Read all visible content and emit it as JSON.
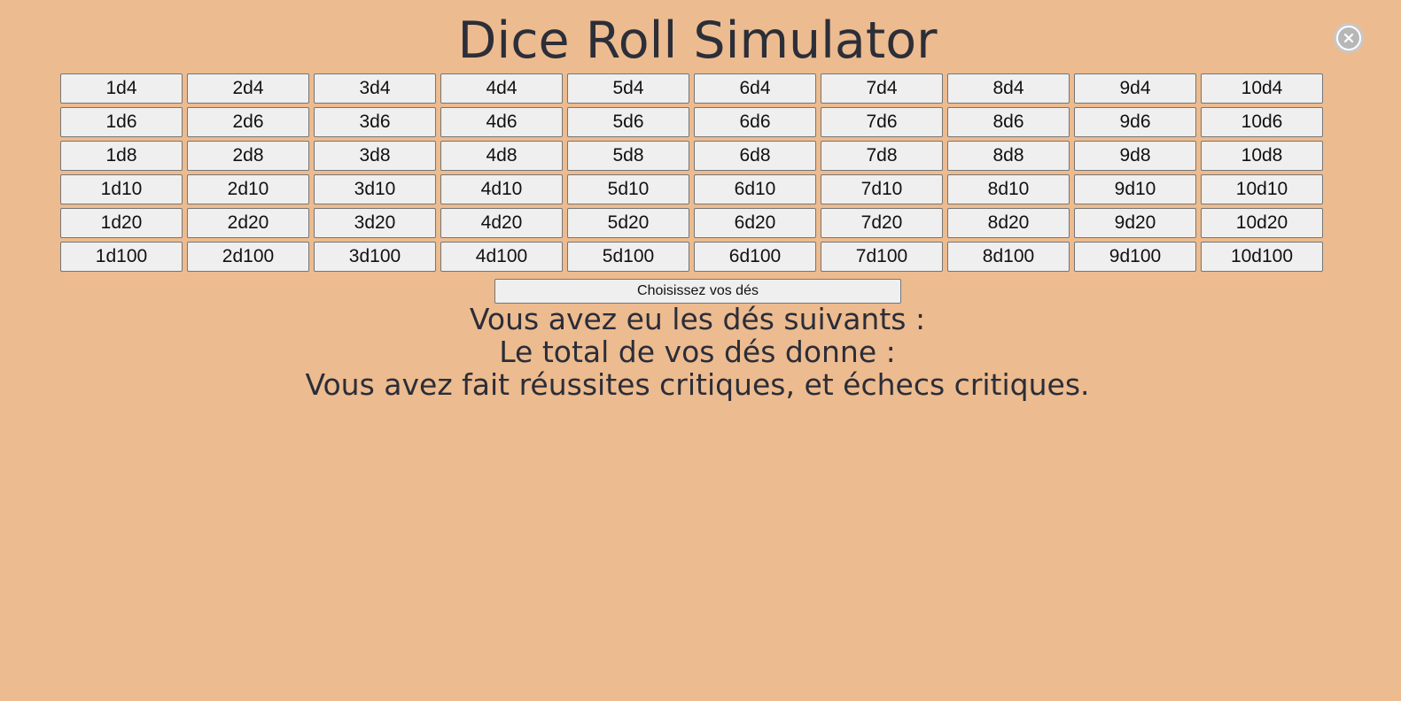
{
  "header": {
    "title": "Dice Roll Simulator",
    "close_icon": "close-icon"
  },
  "dice_grid": {
    "rows": [
      [
        "1d4",
        "2d4",
        "3d4",
        "4d4",
        "5d4",
        "6d4",
        "7d4",
        "8d4",
        "9d4",
        "10d4"
      ],
      [
        "1d6",
        "2d6",
        "3d6",
        "4d6",
        "5d6",
        "6d6",
        "7d6",
        "8d6",
        "9d6",
        "10d6"
      ],
      [
        "1d8",
        "2d8",
        "3d8",
        "4d8",
        "5d8",
        "6d8",
        "7d8",
        "8d8",
        "9d8",
        "10d8"
      ],
      [
        "1d10",
        "2d10",
        "3d10",
        "4d10",
        "5d10",
        "6d10",
        "7d10",
        "8d10",
        "9d10",
        "10d10"
      ],
      [
        "1d20",
        "2d20",
        "3d20",
        "4d20",
        "5d20",
        "6d20",
        "7d20",
        "8d20",
        "9d20",
        "10d20"
      ],
      [
        "1d100",
        "2d100",
        "3d100",
        "4d100",
        "5d100",
        "6d100",
        "7d100",
        "8d100",
        "9d100",
        "10d100"
      ]
    ]
  },
  "choose_button": {
    "label": "Choisissez vos dés"
  },
  "results": {
    "dice_line": "Vous avez eu les dés suivants :",
    "total_line": "Le total de vos dés donne :",
    "critical_line": "Vous avez fait réussites critiques, et échecs critiques."
  },
  "colors": {
    "background": "#ecbb8f",
    "text": "#2b2d38",
    "button_bg": "#efefef",
    "button_border": "#767676"
  }
}
